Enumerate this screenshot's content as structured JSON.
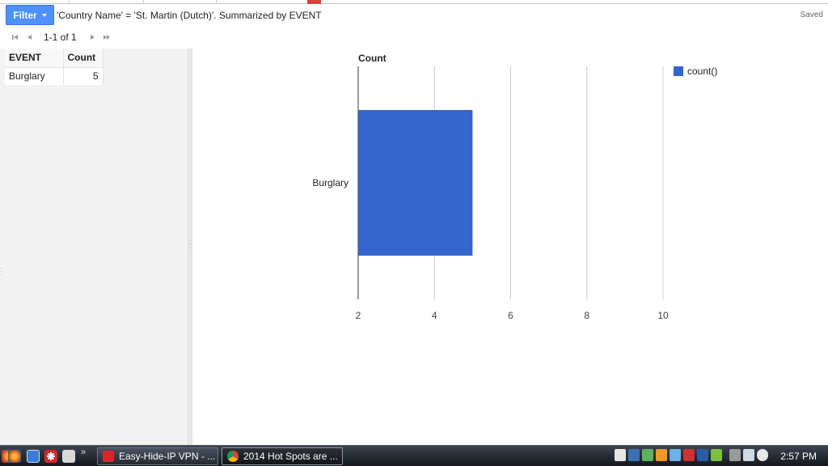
{
  "toolbar": {
    "filter_label": "Filter",
    "filter_description": "'Country Name' = 'St. Martin (Dutch)'. Summarized by EVENT",
    "save_status": "Saved"
  },
  "pager": {
    "range_text": "1-1 of 1"
  },
  "table": {
    "columns": [
      "EVENT",
      "Count"
    ],
    "rows": [
      {
        "event": "Burglary",
        "count": "5"
      }
    ]
  },
  "chart_data": {
    "type": "bar",
    "orientation": "horizontal",
    "title": "Count",
    "categories": [
      "Burglary"
    ],
    "series": [
      {
        "name": "count()",
        "values": [
          5
        ],
        "color": "#3366cc"
      }
    ],
    "xlim": [
      2,
      10
    ],
    "xticks": [
      "2",
      "4",
      "6",
      "8",
      "10"
    ],
    "grid": true,
    "legend": "top-right"
  },
  "taskbar": {
    "tasks": [
      {
        "label": "Easy-Hide-IP VPN - ...",
        "icon": "vpn-app-icon",
        "color": "#d9262b"
      },
      {
        "label": "2014 Hot Spots are ...",
        "icon": "chrome-icon",
        "color": "#e8b321"
      }
    ],
    "clock": "2:57 PM"
  }
}
